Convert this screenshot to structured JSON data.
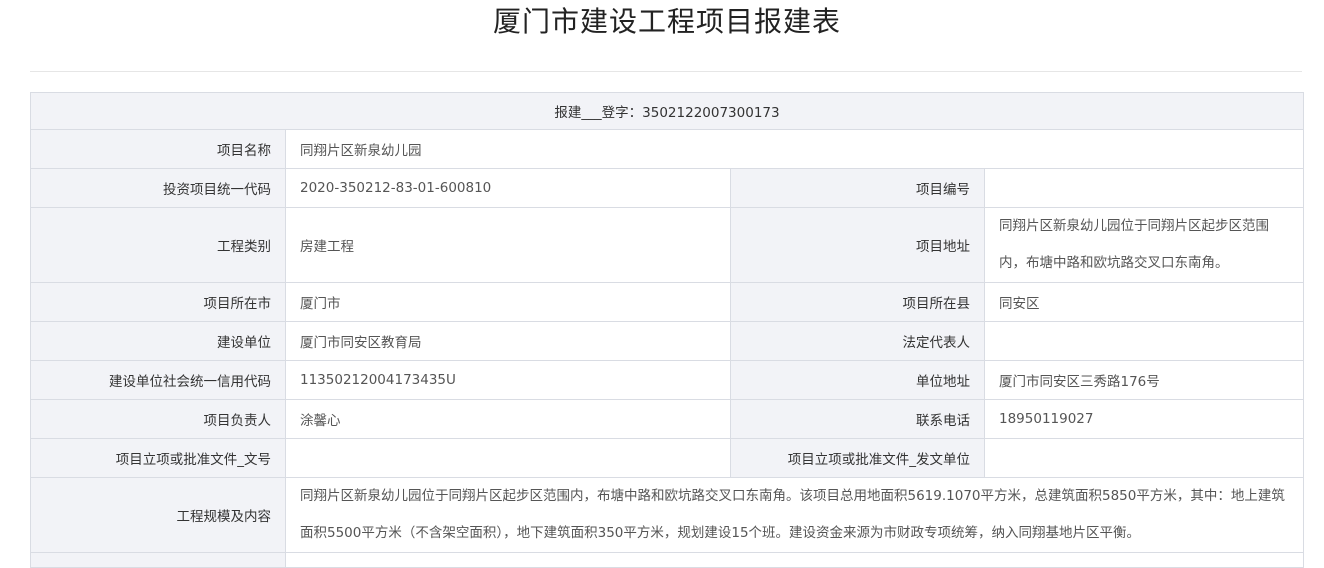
{
  "page": {
    "title": "厦门市建设工程项目报建表"
  },
  "form": {
    "registration": "报建___登字：3502122007300173",
    "rows": {
      "project_name_label": "项目名称",
      "project_name_value": "同翔片区新泉幼儿园",
      "invest_code_label": "投资项目统一代码",
      "invest_code_value": "2020-350212-83-01-600810",
      "project_no_label": "项目编号",
      "project_no_value": "",
      "category_label": "工程类别",
      "category_value": "房建工程",
      "address_label": "项目地址",
      "address_value": "同翔片区新泉幼儿园位于同翔片区起步区范围内，布塘中路和欧坑路交叉口东南角。",
      "city_label": "项目所在市",
      "city_value": "厦门市",
      "county_label": "项目所在县",
      "county_value": "同安区",
      "builder_label": "建设单位",
      "builder_value": "厦门市同安区教育局",
      "legal_rep_label": "法定代表人",
      "legal_rep_value": "",
      "credit_code_label": "建设单位社会统一信用代码",
      "credit_code_value": "11350212004173435U",
      "unit_address_label": "单位地址",
      "unit_address_value": "厦门市同安区三秀路176号",
      "manager_label": "项目负责人",
      "manager_value": "涂馨心",
      "phone_label": "联系电话",
      "phone_value": "18950119027",
      "approval_doc_no_label": "项目立项或批准文件_文号",
      "approval_doc_no_value": "",
      "approval_doc_unit_label": "项目立项或批准文件_发文单位",
      "approval_doc_unit_value": "",
      "scale_label": "工程规模及内容",
      "scale_value": "同翔片区新泉幼儿园位于同翔片区起步区范围内，布塘中路和欧坑路交叉口东南角。该项目总用地面积5619.1070平方米，总建筑面积5850平方米，其中：地上建筑面积5500平方米（不含架空面积），地下建筑面积350平方米，规划建设15个班。建设资金来源为市财政专项统筹，纳入同翔基地片区平衡。"
    }
  }
}
